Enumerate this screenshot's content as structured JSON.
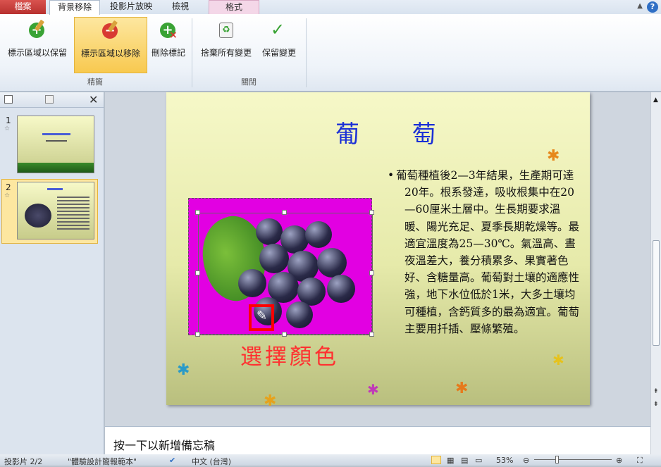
{
  "tabs": [
    "檔案",
    "背景移除",
    "投影片放映",
    "檢視",
    "格式"
  ],
  "ribbon": {
    "mark_keep": "標示區域以保留",
    "mark_remove": "標示區域以移除",
    "delete_mark": "刪除標記",
    "discard": "捨棄所有變更",
    "keep_changes": "保留變更",
    "group_refine": "精簡",
    "group_close": "關閉"
  },
  "slides_panel": {
    "n1": "1",
    "n2": "2"
  },
  "slide": {
    "title": "葡 萄",
    "body": "葡萄種植後2—3年結果，生產期可達20年。根系發達，吸收根集中在20—60厘米土層中。生長期要求溫暖、陽光充足、夏季長期乾燥等。最適宜溫度為25—30℃。氣溫高、晝夜溫差大，養分積累多、果實著色好、含糖量高。葡萄對土壤的適應性強，地下水位低於1米，大多土壤均可種植，含鈣質多的最為適宜。葡萄主要用扦插、壓條繁殖。",
    "annotation": "選擇顏色"
  },
  "notes_placeholder": "按一下以新增備忘稿",
  "status": {
    "slide": "投影片 2/2",
    "theme": "\"體驗設計簡報範本\"",
    "lang": "中文 (台灣)",
    "zoom": "53%"
  },
  "colors": {
    "accent_file": "#b8312f",
    "title": "#1a2fd6",
    "annotation": "#ff3030",
    "bg_removal": "#e200e2"
  }
}
